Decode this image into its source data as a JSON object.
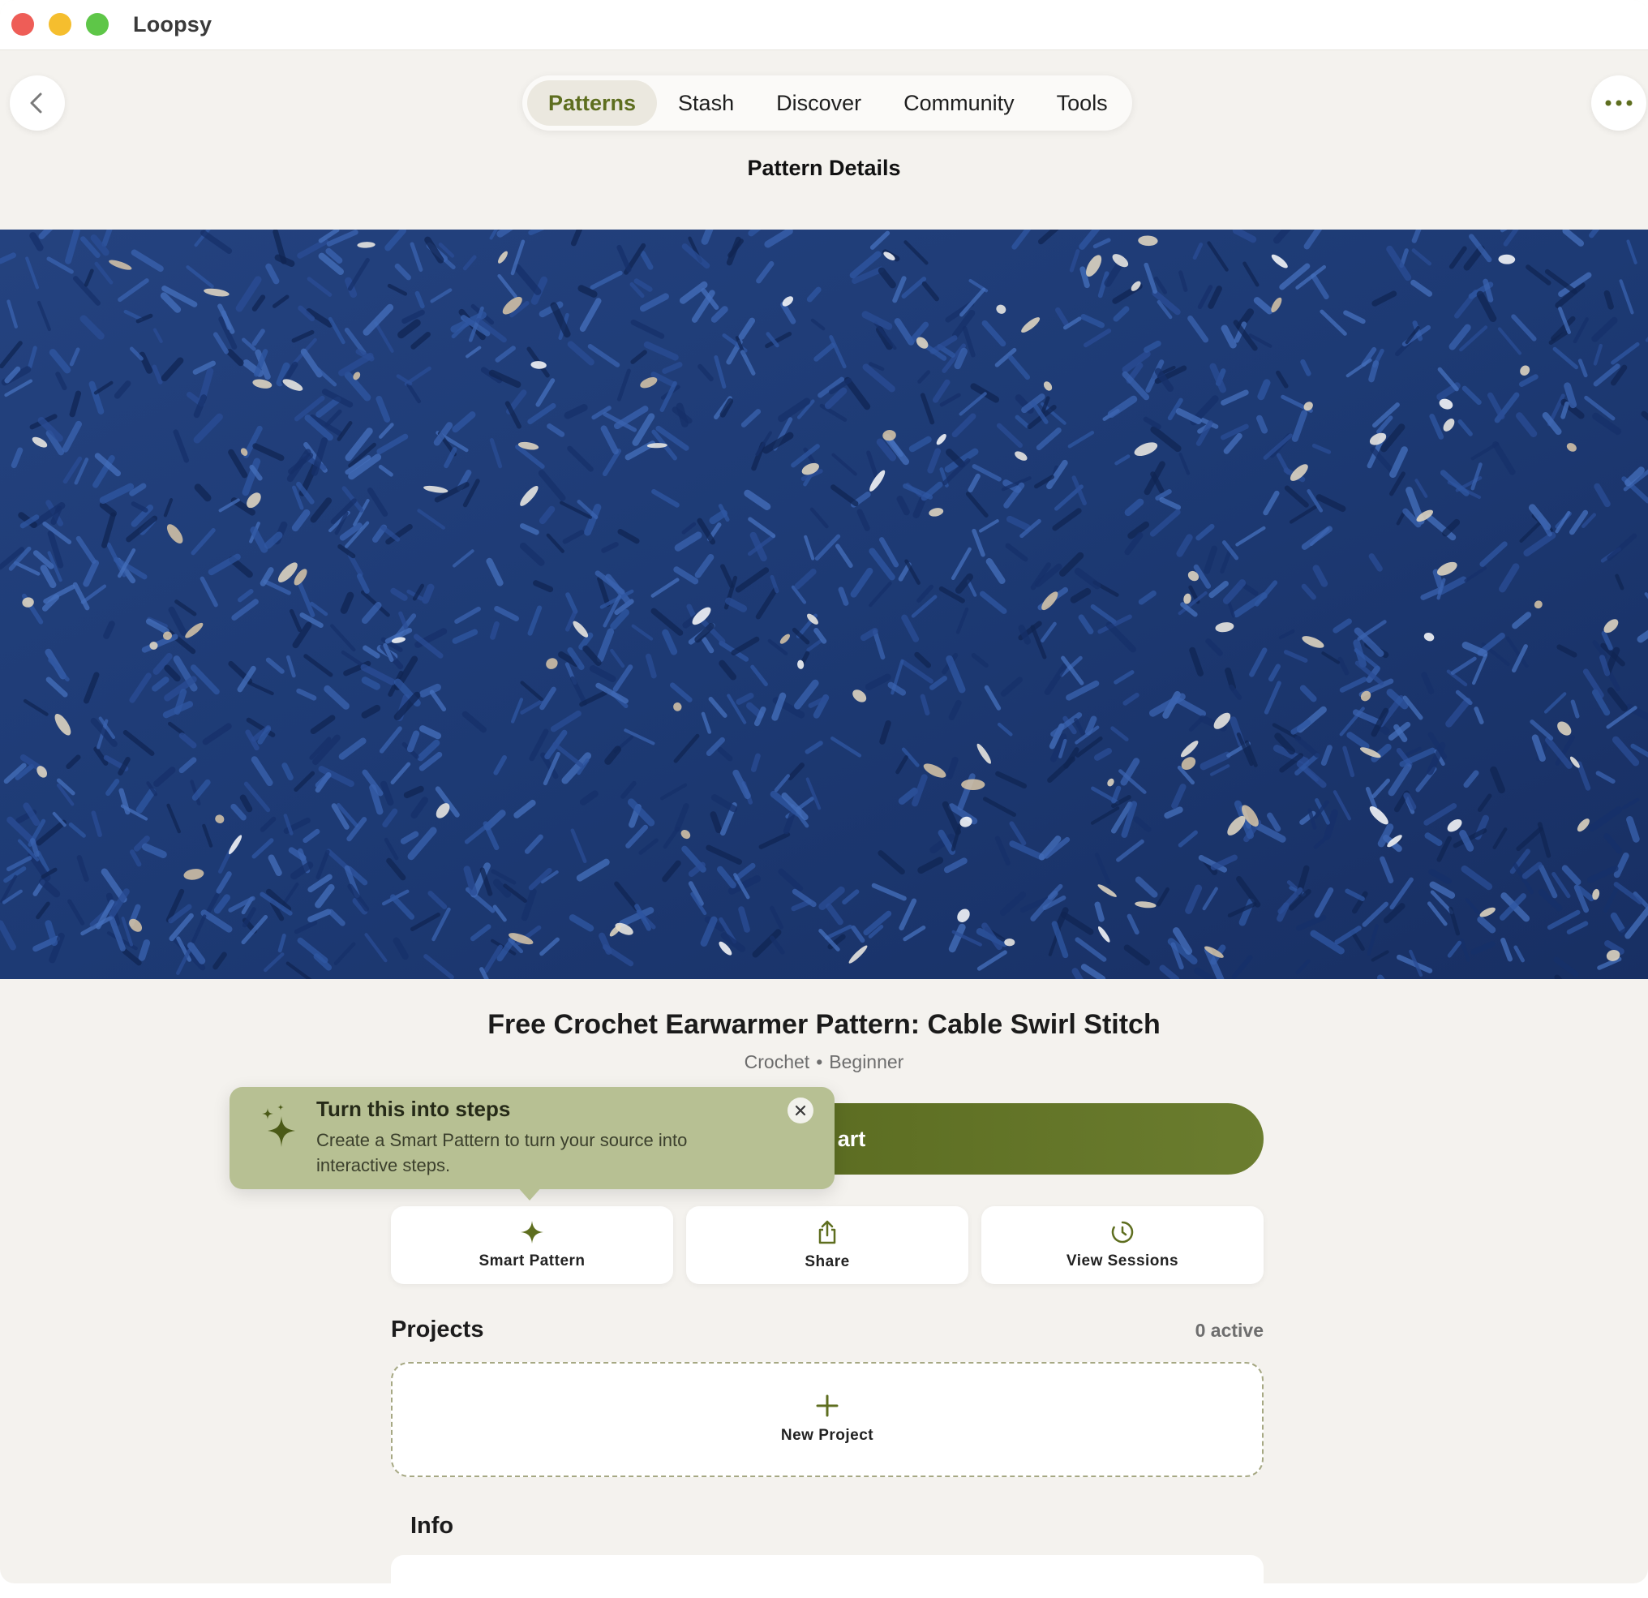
{
  "app": {
    "title": "Loopsy"
  },
  "nav": {
    "tabs": [
      {
        "label": "Patterns",
        "active": true
      },
      {
        "label": "Stash",
        "active": false
      },
      {
        "label": "Discover",
        "active": false
      },
      {
        "label": "Community",
        "active": false
      },
      {
        "label": "Tools",
        "active": false
      }
    ]
  },
  "page": {
    "heading": "Pattern Details"
  },
  "pattern": {
    "title": "Free Crochet Earwarmer Pattern: Cable Swirl Stitch",
    "craft": "Crochet",
    "separator": "•",
    "level": "Beginner"
  },
  "primary_action": {
    "label_visible": "art"
  },
  "actions": {
    "smart_pattern": "Smart Pattern",
    "share": "Share",
    "view_sessions": "View Sessions"
  },
  "projects": {
    "title": "Projects",
    "active_count": "0 active",
    "new_project": "New Project"
  },
  "info": {
    "title": "Info"
  },
  "tooltip": {
    "title": "Turn this into steps",
    "body": "Create a Smart Pattern to turn your source into interactive steps."
  },
  "colors": {
    "accent": "#5e6e1f",
    "button": "#6b7d2f",
    "background": "#f4f2ee",
    "tooltip": "#b7c093"
  },
  "icons": [
    "chevron-left-icon",
    "ellipsis-icon",
    "sparkle-icon",
    "share-icon",
    "history-icon",
    "plus-icon",
    "sparkles-icon",
    "close-icon"
  ]
}
